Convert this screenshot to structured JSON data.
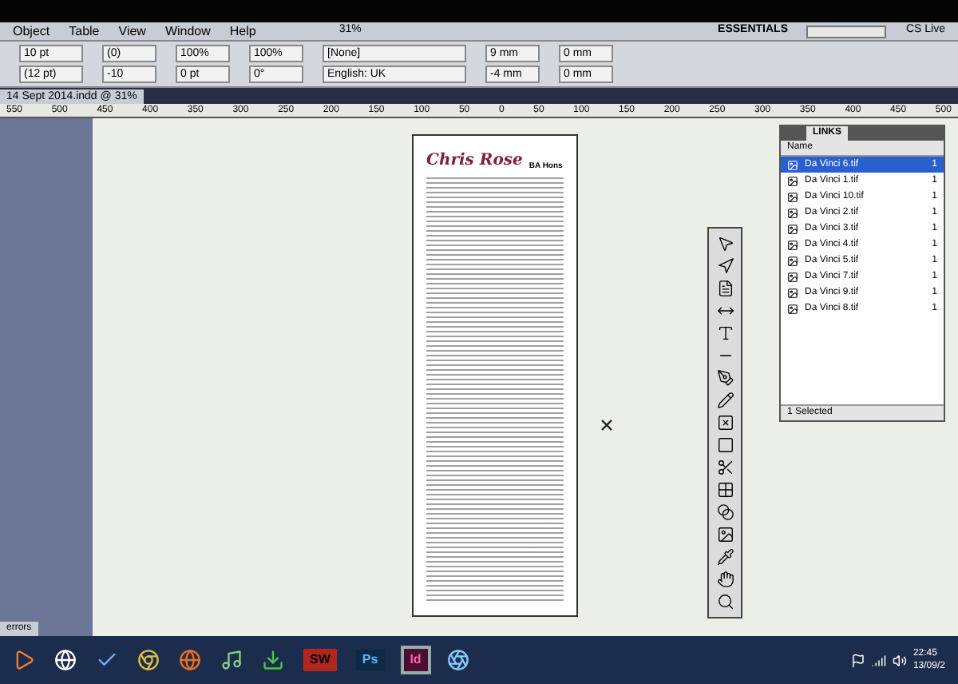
{
  "menu_bar": {
    "items": [
      "Object",
      "Table",
      "View",
      "Window",
      "Help"
    ],
    "zoom": "31%",
    "workspace": "ESSENTIALS",
    "cs_live": "CS Live"
  },
  "control_bar": {
    "font_size": "10 pt",
    "leading": "(12 pt)",
    "kerning": "(0)",
    "tracking": "-10",
    "vertical_scale": "100%",
    "baseline_shift": "0 pt",
    "horizontal_scale": "100%",
    "skew": "0°",
    "character_style": "[None]",
    "language": "English: UK",
    "left_indent": "9 mm",
    "first_line_indent": "-4 mm",
    "space_before": "0 mm",
    "space_after": "0 mm"
  },
  "document_tabs": [
    {
      "label": "14 Sept 2014.indd @ 31%",
      "selected": true
    }
  ],
  "ruler": {
    "ticks": [
      "550",
      "500",
      "450",
      "400",
      "350",
      "300",
      "250",
      "200",
      "150",
      "100",
      "50",
      "0",
      "50",
      "100",
      "150",
      "200",
      "250",
      "300",
      "350",
      "400",
      "450",
      "500"
    ]
  },
  "document": {
    "title": "Chris Rose",
    "subtitle": "BA Hons"
  },
  "links_panel": {
    "tab": "LINKS",
    "column": "Name",
    "items": [
      {
        "name": "Da Vinci 6.tif",
        "page": "1",
        "selected": true
      },
      {
        "name": "Da Vinci 1.tif",
        "page": "1",
        "selected": false
      },
      {
        "name": "Da Vinci 10.tif",
        "page": "1",
        "selected": false
      },
      {
        "name": "Da Vinci 2.tif",
        "page": "1",
        "selected": false
      },
      {
        "name": "Da Vinci 3.tif",
        "page": "1",
        "selected": false
      },
      {
        "name": "Da Vinci 4.tif",
        "page": "1",
        "selected": false
      },
      {
        "name": "Da Vinci 5.tif",
        "page": "1",
        "selected": false
      },
      {
        "name": "Da Vinci 7.tif",
        "page": "1",
        "selected": false
      },
      {
        "name": "Da Vinci 9.tif",
        "page": "1",
        "selected": false
      },
      {
        "name": "Da Vinci 8.tif",
        "page": "1",
        "selected": false
      }
    ],
    "footer": "1 Selected"
  },
  "status_bar": {
    "errors": "errors"
  },
  "taskbar": {
    "apps": [
      {
        "label": "SW",
        "selected": false
      },
      {
        "label": "Ps",
        "selected": false
      },
      {
        "label": "Id",
        "selected": true
      }
    ],
    "time": "22:45",
    "date": "13/09/2"
  }
}
